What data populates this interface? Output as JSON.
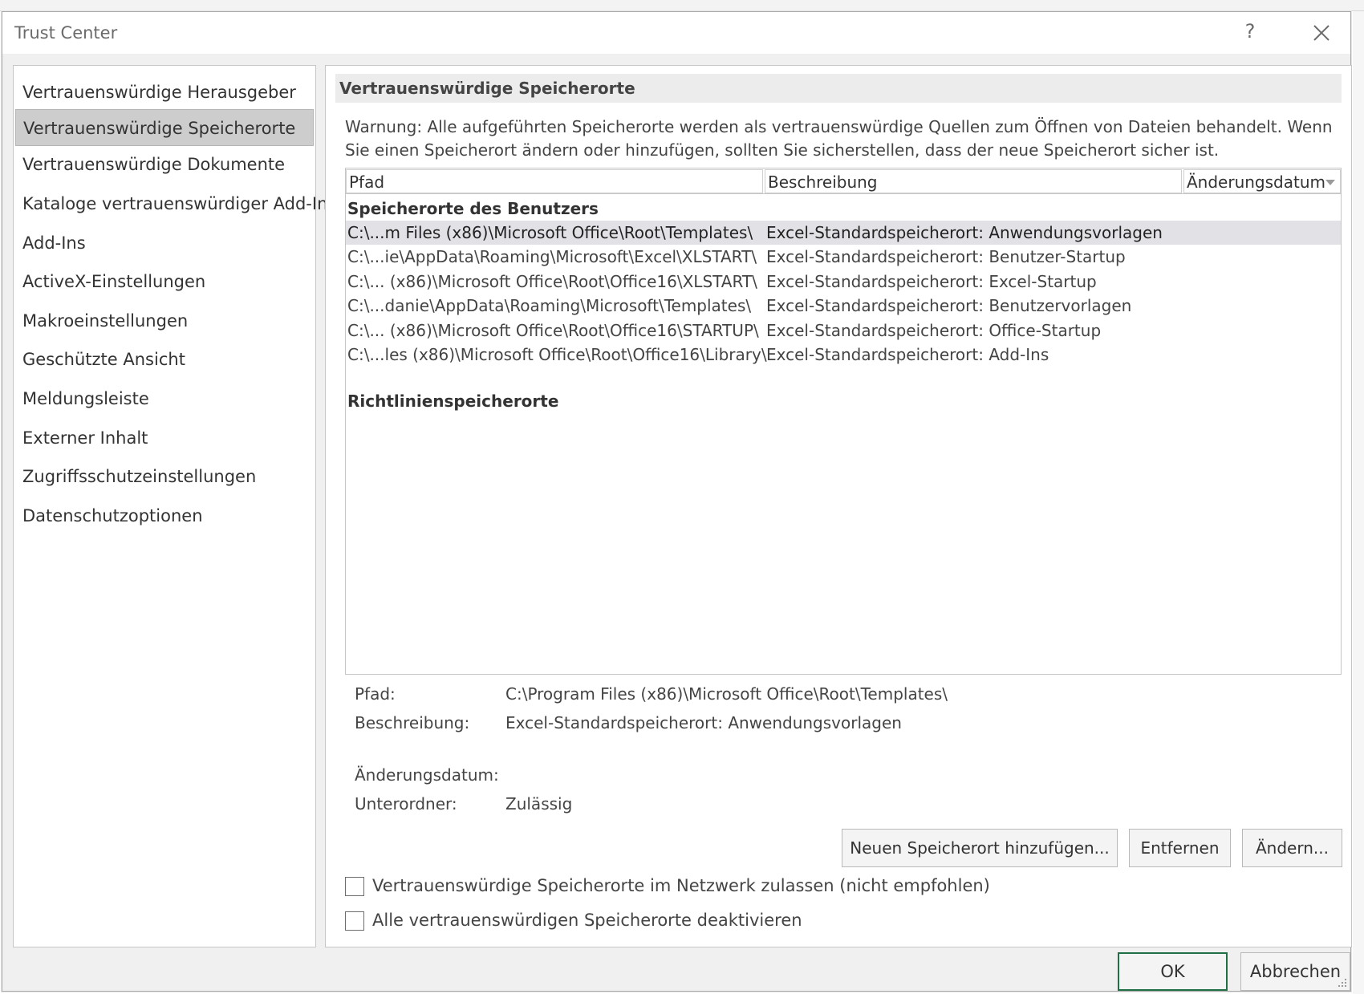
{
  "dialog": {
    "title": "Trust Center",
    "help_glyph": "?"
  },
  "nav": {
    "items": [
      {
        "label": "Vertrauenswürdige Herausgeber"
      },
      {
        "label": "Vertrauenswürdige Speicherorte"
      },
      {
        "label": "Vertrauenswürdige Dokumente"
      },
      {
        "label": "Kataloge vertrauenswürdiger Add-Ins"
      },
      {
        "label": "Add-Ins"
      },
      {
        "label": "ActiveX-Einstellungen"
      },
      {
        "label": "Makroeinstellungen"
      },
      {
        "label": "Geschützte Ansicht"
      },
      {
        "label": "Meldungsleiste"
      },
      {
        "label": "Externer Inhalt"
      },
      {
        "label": "Zugriffsschutzeinstellungen"
      },
      {
        "label": "Datenschutzoptionen"
      }
    ],
    "selected_index": 1
  },
  "content": {
    "section_title": "Vertrauenswürdige Speicherorte",
    "warning": "Warnung: Alle aufgeführten Speicherorte werden als vertrauenswürdige Quellen zum Öffnen von Dateien behandelt. Wenn Sie einen Speicherort ändern oder hinzufügen, sollten Sie sicherstellen, dass der neue Speicherort sicher ist."
  },
  "table": {
    "columns": [
      "Pfad",
      "Beschreibung",
      "Änderungsdatum"
    ],
    "user_group_title": "Speicherorte des Benutzers",
    "rows": [
      {
        "path": "C:\\...m Files (x86)\\Microsoft Office\\Root\\Templates\\",
        "desc": "Excel-Standardspeicherort: Anwendungsvorlagen"
      },
      {
        "path": "C:\\...ie\\AppData\\Roaming\\Microsoft\\Excel\\XLSTART\\",
        "desc": "Excel-Standardspeicherort: Benutzer-Startup"
      },
      {
        "path": "C:\\... (x86)\\Microsoft Office\\Root\\Office16\\XLSTART\\",
        "desc": "Excel-Standardspeicherort: Excel-Startup"
      },
      {
        "path": "C:\\...danie\\AppData\\Roaming\\Microsoft\\Templates\\",
        "desc": "Excel-Standardspeicherort: Benutzervorlagen"
      },
      {
        "path": "C:\\... (x86)\\Microsoft Office\\Root\\Office16\\STARTUP\\",
        "desc": "Excel-Standardspeicherort: Office-Startup"
      },
      {
        "path": "C:\\...les (x86)\\Microsoft Office\\Root\\Office16\\Library\\",
        "desc": "Excel-Standardspeicherort: Add-Ins"
      }
    ],
    "selected_row": 0,
    "policy_group_title": "Richtlinienspeicherorte"
  },
  "details": {
    "path_label": "Pfad:",
    "path_value": "C:\\Program Files (x86)\\Microsoft Office\\Root\\Templates\\",
    "desc_label": "Beschreibung:",
    "desc_value": "Excel-Standardspeicherort: Anwendungsvorlagen",
    "date_label": "Änderungsdatum:",
    "subfolders_label": "Unterordner:",
    "subfolders_value": "Zulässig"
  },
  "buttons": {
    "add": "Neuen Speicherort hinzufügen...",
    "remove": "Entfernen",
    "modify": "Ändern...",
    "ok": "OK",
    "cancel": "Abbrechen"
  },
  "checkboxes": {
    "network": {
      "label": "Vertrauenswürdige Speicherorte im Netzwerk zulassen (nicht empfohlen)",
      "checked": false
    },
    "disable_all": {
      "label": "Alle vertrauenswürdigen Speicherorte deaktivieren",
      "checked": false
    }
  },
  "colors": {
    "ok_border": "#1f7145",
    "selection": "#e1e1e6",
    "nav_selected": "#cdcdcd"
  }
}
